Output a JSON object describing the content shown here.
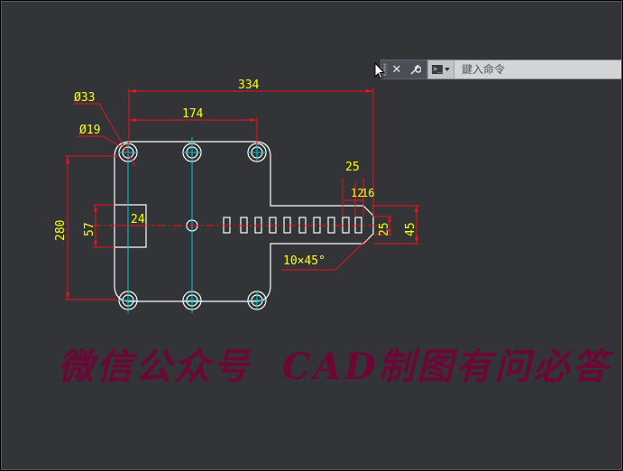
{
  "command_line": {
    "placeholder": "鍵入命令",
    "close_icon": "close-icon",
    "customize_icon": "wrench-icon",
    "prompt_icon": "command-prompt-icon"
  },
  "dimensions": {
    "overall_width": "334",
    "top_width": "174",
    "hole_large": "Ø33",
    "hole_small": "Ø19",
    "height": "280",
    "notch_height": "57",
    "notch_depth": "24",
    "slot_pitch": "25",
    "slot_width": "12",
    "slot_gap": "16",
    "arm_height": "25",
    "arm_total": "45",
    "chamfer": "10×45°"
  },
  "watermark": "微信公众号  CAD制图有问必答",
  "colors": {
    "background": "#333437",
    "geometry": "#ffffff",
    "dimension_lines": "#e8151b",
    "dimension_text": "#ffff00",
    "centerline": "#00c8d8",
    "watermark": "#6b0635"
  }
}
